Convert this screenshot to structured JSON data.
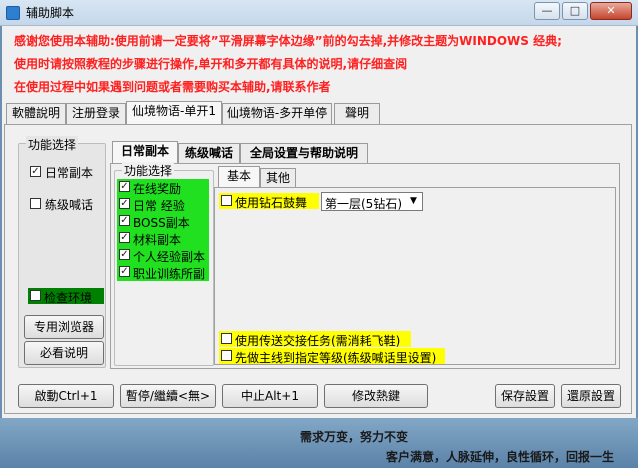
{
  "window": {
    "title": "辅助脚本",
    "minimize": "—",
    "maximize": "□",
    "close": "✕"
  },
  "notices": [
    "感谢您使用本辅助:使用前请一定要将”平滑屏幕字体边缘”前的勾去掉,并修改主题为WINDOWS 经典;",
    "使用时请按照教程的步骤进行操作,单开和多开都有具体的说明,请仔细查阅",
    "在使用过程中如果遇到问题或者需要购买本辅助,请联系作者"
  ],
  "top_tabs": [
    "軟體說明",
    "注册登录",
    "仙境物语-单开1",
    "仙境物语-多开单停",
    "聲明"
  ],
  "function_select": {
    "title": "功能选择",
    "daily": "日常副本",
    "daily_checked": true,
    "leveling": "练级喊话",
    "leveling_checked": false,
    "check_env": "检查环境",
    "check_env_checked": false,
    "browser_btn": "专用浏览器",
    "guide_btn": "必看说明"
  },
  "sub_tabs": [
    "日常副本",
    "练级喊话",
    "全局设置与帮助说明"
  ],
  "daily_functions": {
    "title": "功能选择",
    "items": [
      {
        "label": "在线奖励",
        "checked": true
      },
      {
        "label": "日常 经验",
        "checked": true
      },
      {
        "label": "BOSS副本",
        "checked": true
      },
      {
        "label": "材料副本",
        "checked": true
      },
      {
        "label": "个人经验副本",
        "checked": true
      },
      {
        "label": "职业训练所副",
        "checked": true
      }
    ]
  },
  "inner_tabs": [
    "基本",
    "其他"
  ],
  "basic": {
    "diamond": "使用钻石鼓舞",
    "diamond_checked": false,
    "diamond_select": "第一层(5钻石)",
    "teleport": "使用传送交接任务(需消耗飞鞋)",
    "teleport_checked": false,
    "mainline": "先做主线到指定等级(练级喊话里设置)",
    "mainline_checked": false
  },
  "buttons": {
    "start": "啟動Ctrl+1",
    "pause": "暫停/繼續<無>",
    "stop": "中止Alt+1",
    "hotkey": "修改熱鍵",
    "save": "保存設置",
    "restore": "還原設置"
  },
  "footer": {
    "line1": "需求万变，努力不变",
    "line2": "客户满意，人脉延伸，良性循环，回报一生"
  },
  "colors": {
    "notice": "#ff2020",
    "highlight_green": "#20e020",
    "highlight_yellow": "#ffff00"
  }
}
